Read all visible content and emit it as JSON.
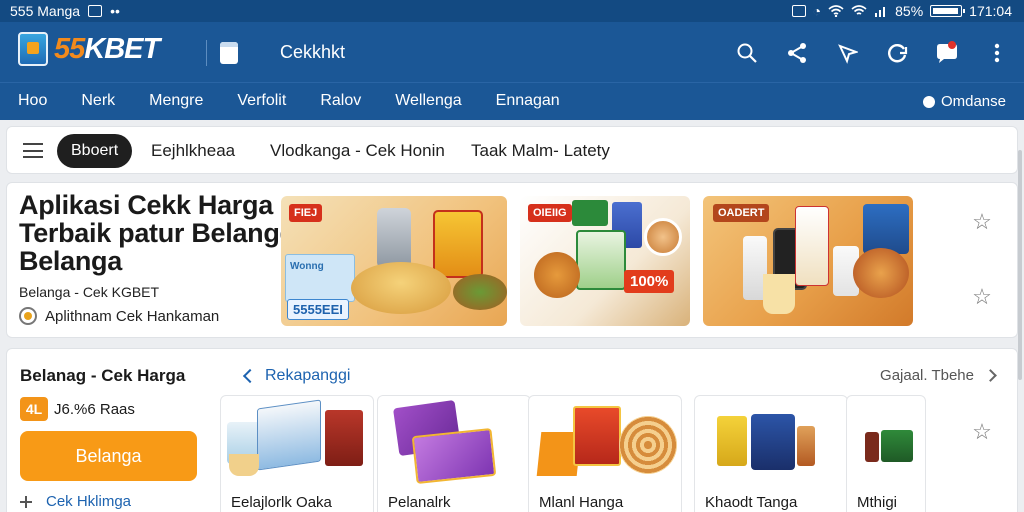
{
  "status_bar": {
    "app_name": "555 Manga",
    "battery": "85%",
    "time": "171:04"
  },
  "app_bar": {
    "logo_number": "55",
    "logo_word": "KBET",
    "title": "Cekkhkt",
    "icons": [
      "search-icon",
      "share-icon",
      "download-icon",
      "refresh-icon",
      "notification-icon",
      "more-vert-icon"
    ]
  },
  "nav": {
    "tabs": [
      "Hoo",
      "Nerk",
      "Mengre",
      "Verfolit",
      "Ralov",
      "Wellenga",
      "Ennagan"
    ],
    "user_label": "Omdanse"
  },
  "filter": {
    "active_chip": "Bboert",
    "chips": [
      "Eejhlkheaa",
      "Vlodkanga -  Cek Honin",
      "Taak Malm- Latety"
    ]
  },
  "hero": {
    "title": "Aplikasi Cekk Harga Terbaik patur Belangga Belanga",
    "subtitle": "Belanga - Cek KGBET",
    "tagline": "Aplithnam  Cek  Hankaman",
    "banner_tags": {
      "b1_tag": "FIEJ",
      "b1_sticker": "5555EEI",
      "b1_card": "Wonng",
      "b2_tag": "OIEIIG",
      "b2_pct": "100%",
      "b3_tag": "OADERT"
    }
  },
  "panel": {
    "title": "Belanag - Cek Harga",
    "link": "Rekapanggi",
    "see_all": "Gajaal.  Tbehe",
    "price_badge": "4L",
    "price_text": "J6.%6 Raas",
    "buy_button": "Belanga",
    "check_link": "Cek Hklimga",
    "products": [
      {
        "name": "Eelajlorlk Oaka"
      },
      {
        "name": "Pelanalrk"
      },
      {
        "name": "Mlanl Hanga"
      },
      {
        "name": "Khaodt Tanga"
      },
      {
        "name": "Mthigi"
      }
    ]
  },
  "colors": {
    "header_blue": "#1b5796",
    "status_blue": "#134a82",
    "accent_orange": "#f89a16",
    "link_blue": "#1d63b0"
  }
}
